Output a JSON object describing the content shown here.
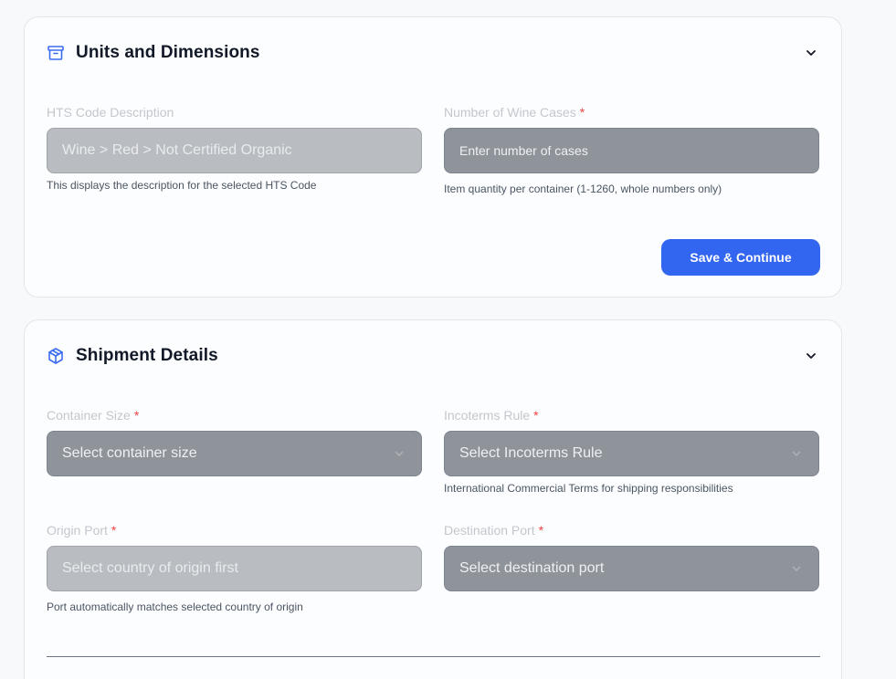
{
  "units_section": {
    "title": "Units and Dimensions",
    "icon": "archive-box-icon",
    "hts_description": {
      "label": "HTS Code Description",
      "value": "Wine > Red > Not Certified Organic",
      "help": "This displays the description for the selected HTS Code"
    },
    "wine_cases": {
      "label": "Number of Wine Cases",
      "required_mark": "*",
      "placeholder": "Enter number of cases",
      "help": "Item quantity per container (1-1260, whole numbers only)"
    },
    "save_button": "Save & Continue"
  },
  "shipment_section": {
    "title": "Shipment Details",
    "icon": "package-cube-icon",
    "container_size": {
      "label": "Container Size",
      "required_mark": "*",
      "placeholder": "Select container size"
    },
    "incoterms": {
      "label": "Incoterms Rule",
      "required_mark": "*",
      "placeholder": "Select Incoterms Rule",
      "help": "International Commercial Terms for shipping responsibilities"
    },
    "origin_port": {
      "label": "Origin Port",
      "required_mark": "*",
      "placeholder": "Select country of origin first",
      "help": "Port automatically matches selected country of origin"
    },
    "destination_port": {
      "label": "Destination Port",
      "required_mark": "*",
      "placeholder": "Select destination port"
    }
  },
  "colors": {
    "accent": "#3366f0",
    "required": "#ef4444",
    "input_fill": "#8f949b",
    "input_disabled_fill": "#b9bdc2"
  }
}
